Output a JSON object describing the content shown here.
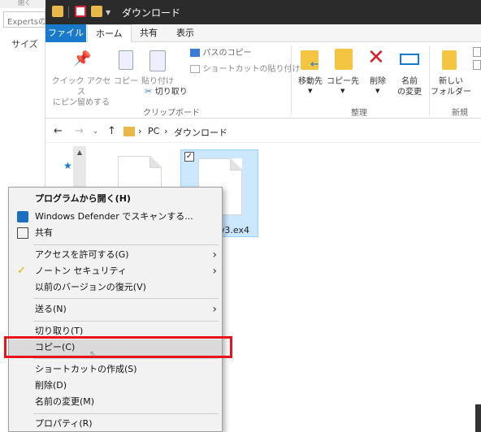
{
  "background_app": {
    "top_text": "閉く",
    "field_text": "Expertsの",
    "column_label": "サイズ"
  },
  "window": {
    "title": "ダウンロード",
    "tabs": [
      "ファイル",
      "ホーム",
      "共有",
      "表示"
    ]
  },
  "ribbon": {
    "pin_label": "クイック アクセス\nにピン留めする",
    "copy_label": "コピー",
    "paste_label": "貼り付け",
    "path_copy": "パスのコピー",
    "shortcut_paste": "ショートカットの貼り付け",
    "cut": "切り取り",
    "clipboard_group": "クリップボード",
    "move_to": "移動先",
    "copy_to": "コピー先",
    "delete": "削除",
    "rename": "名前\nの変更",
    "organize_group": "整理",
    "new_folder": "新しい\nフォルダー",
    "new_group": "新規"
  },
  "address": {
    "crumbs": [
      "PC",
      "ダウンロード"
    ]
  },
  "files": {
    "selected_name": "v3.ex4"
  },
  "context_menu": {
    "open_with": "プログラムから開く(H)",
    "defender": "Windows Defender でスキャンする...",
    "share": "共有",
    "give_access": "アクセスを許可する(G)",
    "norton": "ノートン セキュリティ",
    "restore": "以前のバージョンの復元(V)",
    "send_to": "送る(N)",
    "cut": "切り取り(T)",
    "copy": "コピー(C)",
    "create_shortcut": "ショートカットの作成(S)",
    "delete": "削除(D)",
    "rename": "名前の変更(M)",
    "properties": "プロパティ(R)"
  },
  "colors": {
    "highlight_box": "#e8141c",
    "file_tab": "#1979ca",
    "selection": "#cce8ff"
  }
}
